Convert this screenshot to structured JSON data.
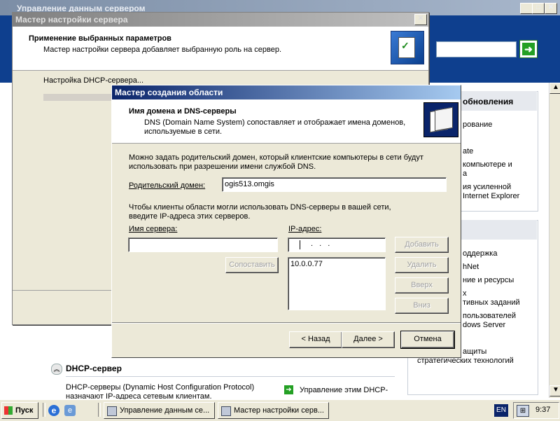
{
  "main_window": {
    "title": "Управление данным сервером",
    "right_items": [
      "обновления",
      "рование",
      "ate",
      "компьютере и",
      "а",
      "ия усиленной",
      "Internet Explorer",
      "оддержка",
      "hNet",
      "ние и ресурсы",
      "х",
      "тивных заданий",
      "пользователей",
      "dows Server",
      "ащиты",
      "стратегических технологий"
    ],
    "dhcp_section": {
      "title": "DHCP-сервер",
      "desc_line1": "DHCP-серверы (Dynamic Host Configuration Protocol)",
      "desc_line2": "назначают IP-адреса сетевым клиентам.",
      "manage_link": "Управление этим DHCP-"
    }
  },
  "setup_wizard": {
    "title": "Мастер настройки сервера",
    "heading": "Применение выбранных параметров",
    "subheading": "Мастер настройки сервера добавляет выбранную роль на сервер.",
    "status": "Настройка DHCP-сервера..."
  },
  "scope_wizard": {
    "title": "Мастер создания области",
    "heading": "Имя домена и DNS-серверы",
    "subheading_line1": "DNS (Domain Name System) сопоставляет и отображает имена доменов,",
    "subheading_line2": "используемые в сети.",
    "intro_line1": "Можно задать родительский домен, который клиентские компьютеры в сети будут",
    "intro_line2": "использовать при разрешении имени службой DNS.",
    "parent_domain_label": "Родительский домен:",
    "parent_domain_value": "ogis513.omgis",
    "dns_info_line1": "Чтобы клиенты области могли использовать DNS-серверы в вашей сети,",
    "dns_info_line2": "введите IP-адреса этих серверов.",
    "server_name_label": "Имя сервера:",
    "ip_label": "IP-адрес:",
    "ip_dots": ".     .     .",
    "resolve_button": "Сопоставить",
    "add_button": "Добавить",
    "remove_button": "Удалить",
    "up_button": "Вверх",
    "down_button": "Вниз",
    "ip_list": [
      "10.0.0.77"
    ],
    "back_button": "< Назад",
    "next_button": "Далее >",
    "cancel_button": "Отмена"
  },
  "taskbar": {
    "start": "Пуск",
    "tasks": [
      "Управление данным се...",
      "Мастер настройки серв..."
    ],
    "lang": "EN",
    "clock": "9:37"
  },
  "colors": {
    "accent": "#0a246a",
    "main_blue": "#0e3f8e",
    "dialog_bg": "#ece9d8",
    "desktop": "#3a6ea5"
  }
}
